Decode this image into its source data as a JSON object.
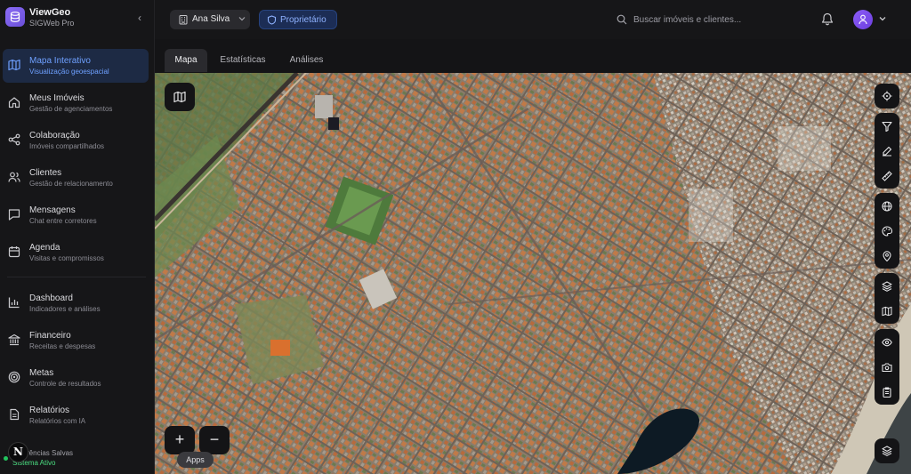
{
  "brand": {
    "title": "ViewGeo",
    "subtitle": "SIGWeb Pro"
  },
  "sidebar": {
    "items": [
      {
        "label": "Mapa Interativo",
        "sub": "Visualização geoespacial",
        "icon": "map-icon",
        "active": true
      },
      {
        "label": "Meus Imóveis",
        "sub": "Gestão de agenciamentos",
        "icon": "home-icon"
      },
      {
        "label": "Colaboração",
        "sub": "Imóveis compartilhados",
        "icon": "share-icon"
      },
      {
        "label": "Clientes",
        "sub": "Gestão de relacionamento",
        "icon": "users-icon"
      },
      {
        "label": "Mensagens",
        "sub": "Chat entre corretores",
        "icon": "message-icon"
      },
      {
        "label": "Agenda",
        "sub": "Visitas e compromissos",
        "icon": "calendar-icon"
      },
      {
        "label": "Dashboard",
        "sub": "Indicadores e análises",
        "icon": "bar-chart-icon"
      },
      {
        "label": "Financeiro",
        "sub": "Receitas e despesas",
        "icon": "bank-icon"
      },
      {
        "label": "Metas",
        "sub": "Controle de resultados",
        "icon": "target-icon"
      },
      {
        "label": "Relatórios",
        "sub": "Relatórios com IA",
        "icon": "report-icon"
      }
    ],
    "footer_text": "rências Salvas",
    "status": "Sistema Ativo",
    "n_badge": "N",
    "apps_tooltip": "Apps"
  },
  "header": {
    "user": "Ana Silva",
    "role": "Proprietário",
    "search_placeholder": "Buscar imóveis e clientes..."
  },
  "tabs": [
    {
      "label": "Mapa",
      "active": true
    },
    {
      "label": "Estatísticas"
    },
    {
      "label": "Análises"
    }
  ],
  "map": {
    "zoom_in": "+",
    "zoom_out": "−",
    "tools": [
      "locate-icon",
      "filter-icon",
      "draw-icon",
      "measure-icon",
      "globe-icon",
      "palette-icon",
      "pin-icon",
      "layers-icon",
      "map-icon",
      "eye-icon",
      "camera-icon",
      "clipboard-icon",
      "layers-icon"
    ]
  },
  "colors": {
    "accent": "#6ea0ff",
    "active_bg": "#1d2a44",
    "brand": "#8b6cf6",
    "status": "#22c55e"
  }
}
